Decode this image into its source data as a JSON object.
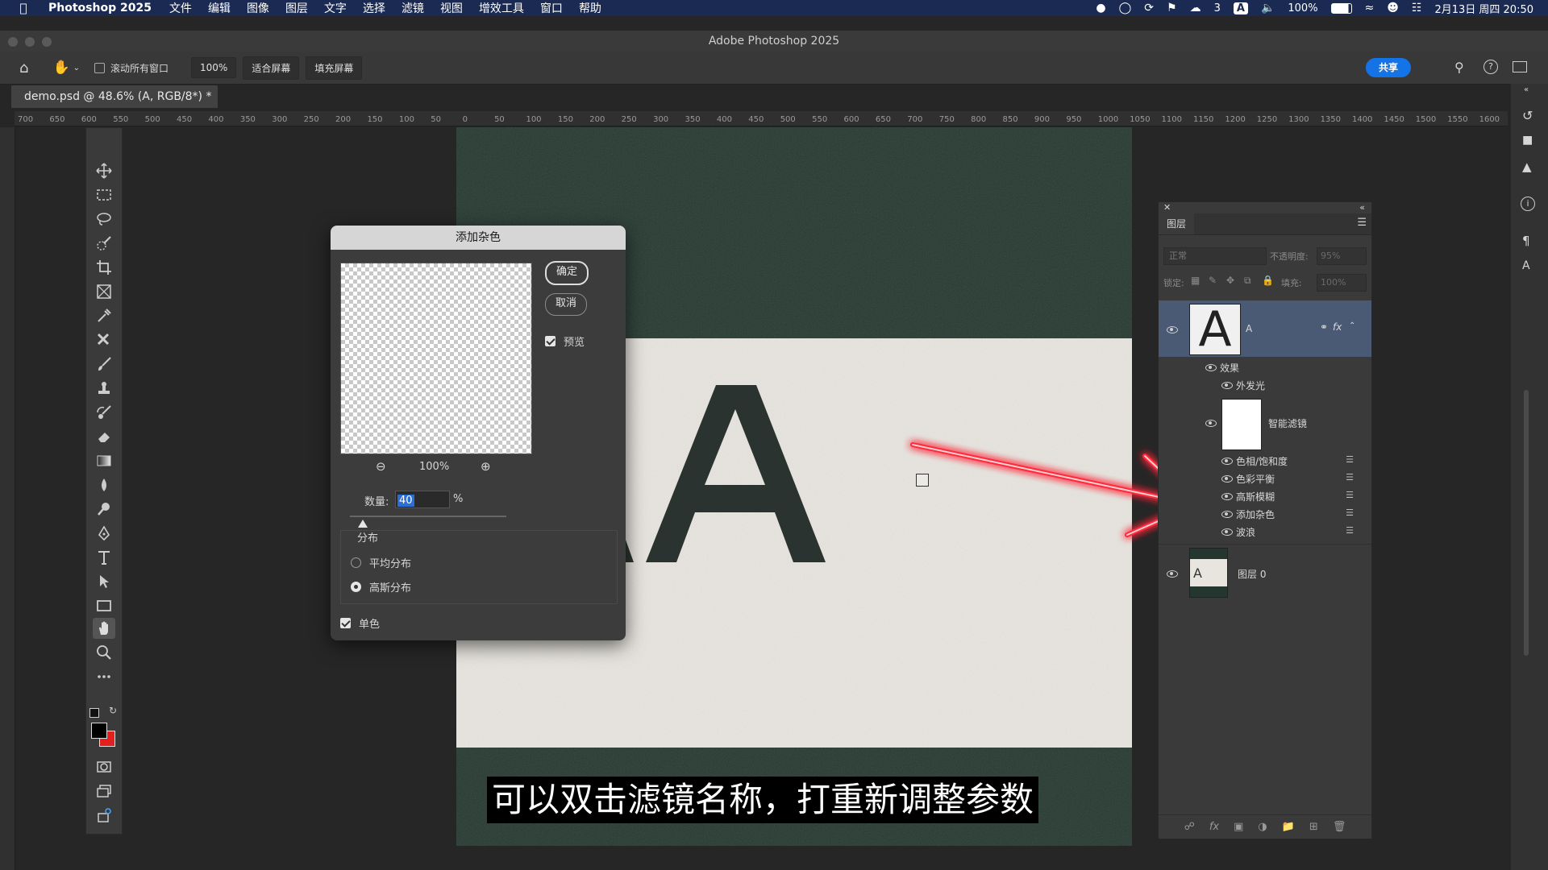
{
  "menubar": {
    "app_name": "Photoshop 2025",
    "items": [
      "文件",
      "编辑",
      "图像",
      "图层",
      "文字",
      "选择",
      "滤镜",
      "视图",
      "增效工具",
      "窗口",
      "帮助"
    ],
    "wechat_count": "3",
    "input_method": "A",
    "battery": "100%",
    "datetime": "2月13日 周四 20:50"
  },
  "window": {
    "title": "Adobe Photoshop 2025"
  },
  "options": {
    "scroll_all_label": "滚动所有窗口",
    "zoom_value": "100%",
    "fit_screen": "适合屏幕",
    "fill_screen": "填充屏幕",
    "share": "共享"
  },
  "document": {
    "tab_label": "demo.psd @ 48.6% (A, RGB/8*) *"
  },
  "ruler": {
    "h_ticks": [
      "700",
      "650",
      "600",
      "550",
      "500",
      "450",
      "400",
      "350",
      "300",
      "250",
      "200",
      "150",
      "100",
      "50",
      "0",
      "50",
      "100",
      "150",
      "200",
      "250",
      "300",
      "350",
      "400",
      "450",
      "500",
      "550",
      "600",
      "650",
      "700",
      "750",
      "800",
      "850",
      "900",
      "950",
      "1000",
      "1050",
      "1100",
      "1150",
      "1200",
      "1250",
      "1300",
      "1350",
      "1400",
      "1450",
      "1500",
      "1550",
      "1600"
    ]
  },
  "dialog": {
    "title": "添加杂色",
    "ok": "确定",
    "cancel": "取消",
    "preview_label": "预览",
    "preview_checked": true,
    "preview_zoom": "100%",
    "amount_label": "数量:",
    "amount_value": "40",
    "amount_unit": "%",
    "amount_level_percent": 40,
    "distribution_label": "分布",
    "distribution_options": [
      "平均分布",
      "高斯分布"
    ],
    "distribution_selected": "高斯分布",
    "mono_label": "单色",
    "mono_checked": true
  },
  "layers_panel": {
    "tab": "图层",
    "blend_mode": "正常",
    "opacity_label": "不透明度:",
    "opacity_value": "95%",
    "lock_label": "锁定:",
    "fill_label": "填充:",
    "fill_value": "100%",
    "layer_a_name": "A",
    "effects_label": "效果",
    "outer_glow": "外发光",
    "smart_filters": "智能滤镜",
    "filters": [
      "色相/饱和度",
      "色彩平衡",
      "高斯模糊",
      "添加杂色",
      "波浪"
    ],
    "layer0_name": "图层 0",
    "layer_thumb_letter": "A"
  },
  "subtitle": "可以双击滤镜名称，打重新调整参数",
  "colors": {
    "accent": "#1473e6",
    "selected_layer": "#4a5a75",
    "arrow": "#ff2a3a",
    "canvas_dark": "#24372f",
    "canvas_light": "#e8e5df"
  }
}
